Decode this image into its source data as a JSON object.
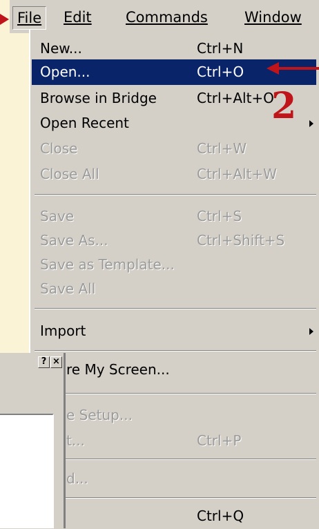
{
  "menubar": {
    "items": [
      {
        "text": "File",
        "mnemonic": "F"
      },
      {
        "text": "Edit",
        "mnemonic": "E"
      },
      {
        "text": "Commands",
        "mnemonic": "C"
      },
      {
        "text": "Window",
        "mnemonic": "W"
      }
    ],
    "active": "File"
  },
  "menu": {
    "items": [
      {
        "label": "New...",
        "shortcut": "Ctrl+N",
        "state": "normal"
      },
      {
        "label": "Open...",
        "shortcut": "Ctrl+O",
        "state": "selected"
      },
      {
        "label": "Browse in Bridge",
        "shortcut": "Ctrl+Alt+O",
        "state": "normal"
      },
      {
        "label": "Open Recent",
        "shortcut": "",
        "state": "normal",
        "submenu": true
      },
      {
        "label": "Close",
        "shortcut": "Ctrl+W",
        "state": "disabled"
      },
      {
        "label": "Close All",
        "shortcut": "Ctrl+Alt+W",
        "state": "disabled"
      },
      {
        "label": "Save",
        "shortcut": "Ctrl+S",
        "state": "disabled"
      },
      {
        "label": "Save As...",
        "shortcut": "Ctrl+Shift+S",
        "state": "disabled"
      },
      {
        "label": "Save as Template...",
        "shortcut": "",
        "state": "disabled"
      },
      {
        "label": "Save All",
        "shortcut": "",
        "state": "disabled"
      },
      {
        "label": "Import",
        "shortcut": "",
        "state": "normal",
        "submenu": true
      },
      {
        "label": "re My Screen...",
        "shortcut": "",
        "state": "normal"
      },
      {
        "label": "e Setup...",
        "shortcut": "",
        "state": "disabled"
      },
      {
        "label": "t...",
        "shortcut": "Ctrl+P",
        "state": "disabled"
      },
      {
        "label": "d...",
        "shortcut": "",
        "state": "disabled"
      },
      {
        "label": "",
        "shortcut": "Ctrl+Q",
        "state": "normal"
      }
    ]
  },
  "annotation": {
    "number": "2",
    "color": "#c0141b"
  },
  "dialog": {
    "help_button": "?",
    "close_button": "×"
  },
  "colors": {
    "selection": "#0a246a",
    "menu_bg": "#d4d0c8",
    "background": "#fbf3d5",
    "disabled": "#9b9b9b"
  }
}
